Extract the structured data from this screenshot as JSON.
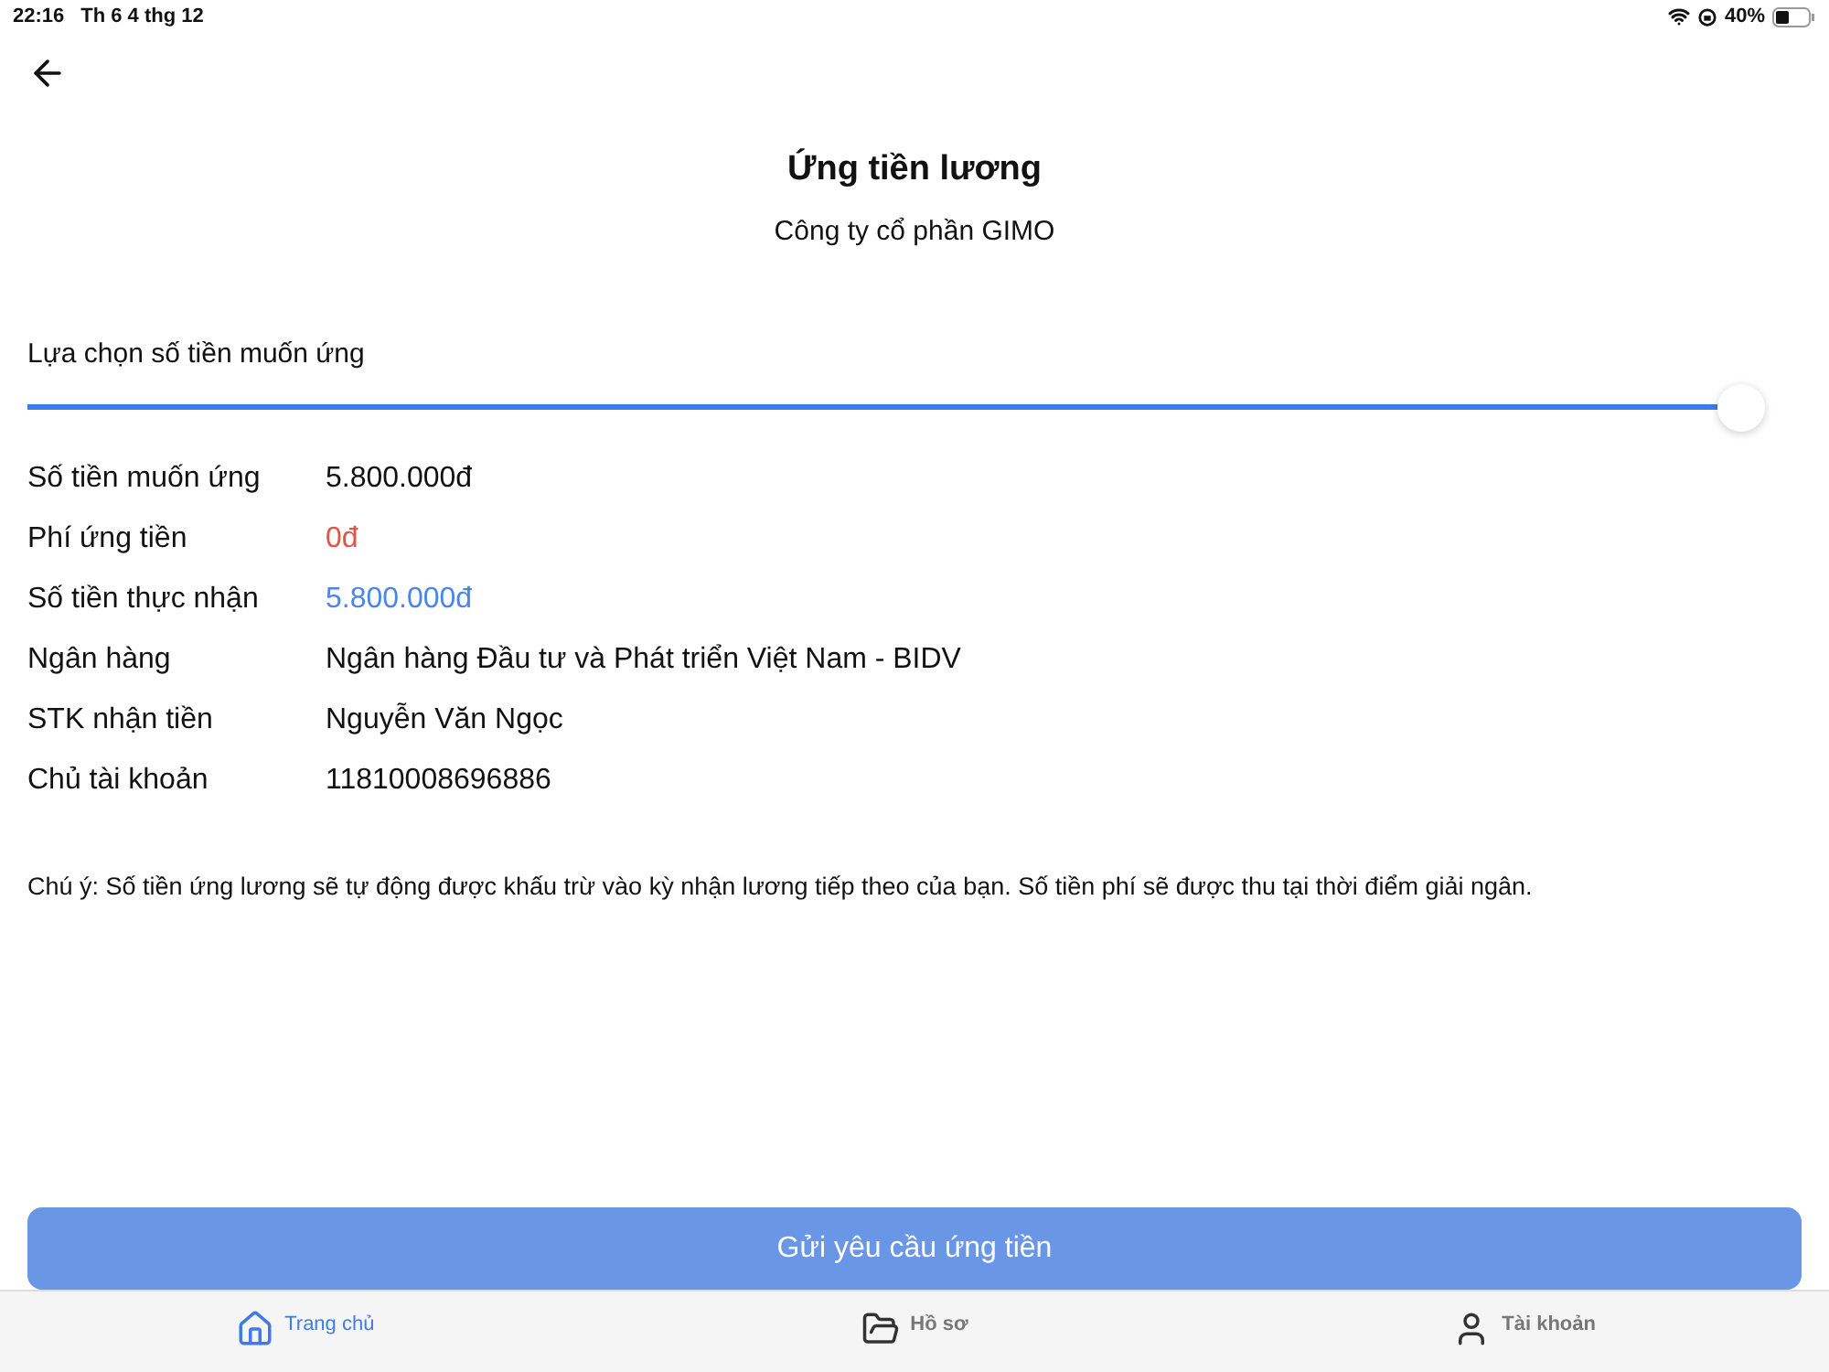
{
  "status_bar": {
    "time": "22:16",
    "date": "Th 6 4 thg 12",
    "battery": "40%"
  },
  "header": {
    "title": "Ứng tiền lương",
    "subtitle": "Công ty cổ phần GIMO"
  },
  "slider": {
    "label": "Lựa chọn số tiền muốn ứng",
    "level": 1
  },
  "details": [
    {
      "label": "Số tiền muốn ứng",
      "value": "5.800.000đ",
      "kind": "plain"
    },
    {
      "label": "Phí ứng tiền",
      "value": "0đ",
      "kind": "fee"
    },
    {
      "label": "Số tiền thực nhận",
      "value": "5.800.000đ",
      "kind": "received"
    },
    {
      "label": "Ngân hàng",
      "value": "Ngân hàng Đầu tư và Phát triển Việt Nam - BIDV",
      "kind": "plain"
    },
    {
      "label": "STK nhận tiền",
      "value": "Nguyễn Văn Ngọc",
      "kind": "plain"
    },
    {
      "label": "Chủ tài khoản",
      "value": "11810008696886",
      "kind": "plain"
    }
  ],
  "note": "Chú ý: Số tiền ứng lương sẽ tự động được khấu trừ vào kỳ nhận lương tiếp theo của bạn. Số tiền phí sẽ được thu tại thời điểm giải ngân.",
  "submit_button": "Gửi yêu cầu ứng tiền",
  "tab_bar": [
    {
      "label": "Trang chủ",
      "kind": "home",
      "selected": true
    },
    {
      "label": "Hồ sơ",
      "kind": "folder",
      "selected": false
    },
    {
      "label": "Tài khoản",
      "kind": "user",
      "selected": false
    }
  ]
}
